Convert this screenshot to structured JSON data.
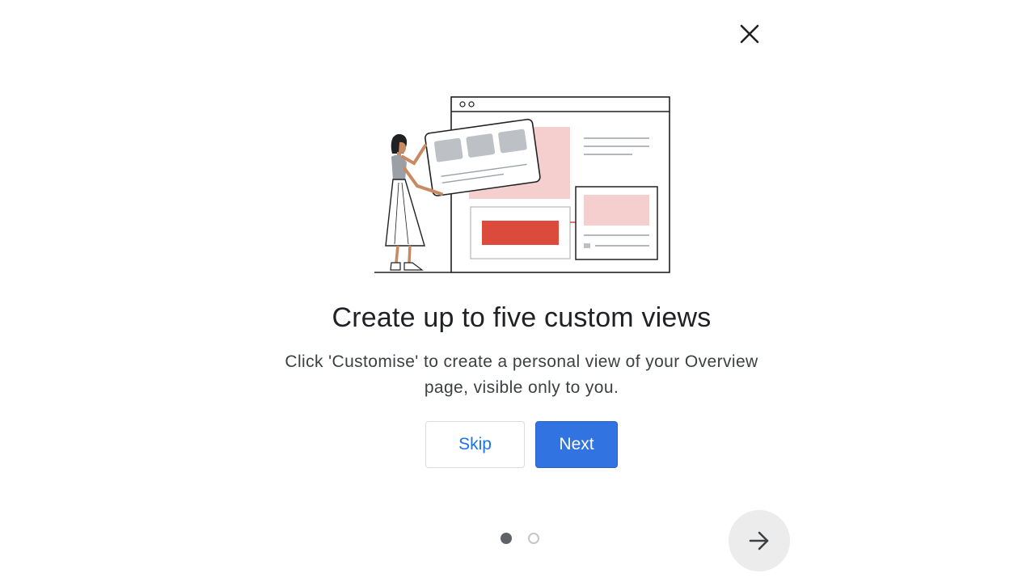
{
  "dialog": {
    "title": "Create up to five custom views",
    "description": "Click 'Customise' to create a personal view of your Overview page, visible only to you.",
    "buttons": {
      "skip_label": "Skip",
      "next_label": "Next"
    },
    "pagination": {
      "total": 2,
      "current": 1
    },
    "icons": {
      "close": "close-icon",
      "next_arrow": "arrow-right-icon",
      "illustration": "custom-views-illustration"
    },
    "colors": {
      "primary": "#3173e0",
      "link": "#1a73e8",
      "accent_red": "#db4a3b",
      "accent_pink": "#f5cfcd"
    }
  }
}
